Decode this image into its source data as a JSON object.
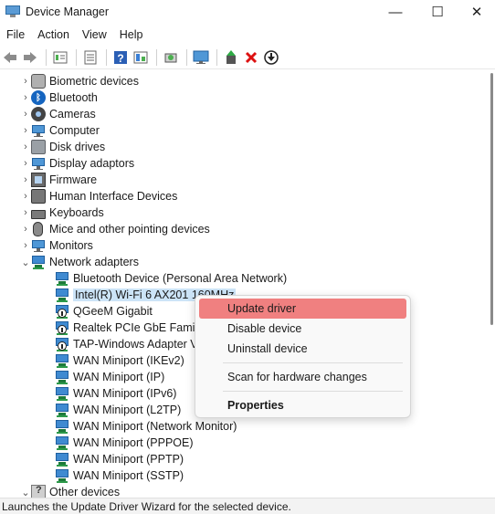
{
  "window": {
    "title": "Device Manager",
    "minimize_glyph": "—",
    "maximize_glyph": "☐",
    "close_glyph": "✕"
  },
  "menu": [
    "File",
    "Action",
    "View",
    "Help"
  ],
  "toolbar": [
    "back-arrow-icon",
    "forward-arrow-icon",
    "properties-view-icon",
    "list-view-icon",
    "help-icon",
    "resources-view-icon",
    "scan-hardware-icon",
    "monitor-icon",
    "update-driver-icon",
    "uninstall-x-icon",
    "disable-device-icon"
  ],
  "tree": {
    "categories": [
      {
        "label": "Biometric devices",
        "icon": "fingerprint-icon",
        "expanded": false
      },
      {
        "label": "Bluetooth",
        "icon": "bluetooth-icon",
        "expanded": false
      },
      {
        "label": "Cameras",
        "icon": "camera-icon",
        "expanded": false
      },
      {
        "label": "Computer",
        "icon": "computer-icon",
        "expanded": false
      },
      {
        "label": "Disk drives",
        "icon": "disk-drive-icon",
        "expanded": false
      },
      {
        "label": "Display adaptors",
        "icon": "display-adapter-icon",
        "expanded": false
      },
      {
        "label": "Firmware",
        "icon": "firmware-icon",
        "expanded": false
      },
      {
        "label": "Human Interface Devices",
        "icon": "hid-icon",
        "expanded": false
      },
      {
        "label": "Keyboards",
        "icon": "keyboard-icon",
        "expanded": false
      },
      {
        "label": "Mice and other pointing devices",
        "icon": "mouse-icon",
        "expanded": false
      },
      {
        "label": "Monitors",
        "icon": "monitor-icon",
        "expanded": false
      },
      {
        "label": "Network adapters",
        "icon": "network-adapter-icon",
        "expanded": true
      }
    ],
    "network_children": [
      {
        "label": "Bluetooth Device (Personal Area Network)",
        "warn": false
      },
      {
        "label": "Intel(R) Wi-Fi 6 AX201 160MHz",
        "warn": false,
        "selected": true
      },
      {
        "label": "QGeeM Gigabit",
        "warn": true
      },
      {
        "label": "Realtek PCIe GbE Family",
        "warn": true
      },
      {
        "label": "TAP-Windows Adapter V9",
        "warn": true
      },
      {
        "label": "WAN Miniport (IKEv2)",
        "warn": false
      },
      {
        "label": "WAN Miniport (IP)",
        "warn": false
      },
      {
        "label": "WAN Miniport (IPv6)",
        "warn": false
      },
      {
        "label": "WAN Miniport (L2TP)",
        "warn": false
      },
      {
        "label": "WAN Miniport (Network Monitor)",
        "warn": false
      },
      {
        "label": "WAN Miniport (PPPOE)",
        "warn": false
      },
      {
        "label": "WAN Miniport (PPTP)",
        "warn": false
      },
      {
        "label": "WAN Miniport (SSTP)",
        "warn": false
      }
    ],
    "trailing": [
      {
        "label": "Other devices",
        "icon": "other-devices-icon",
        "expanded": true
      }
    ]
  },
  "context_menu": {
    "update": "Update driver",
    "disable": "Disable device",
    "uninstall": "Uninstall device",
    "scan": "Scan for hardware changes",
    "properties": "Properties"
  },
  "status": "Launches the Update Driver Wizard for the selected device.",
  "colors": {
    "menu_hover": "#f08080",
    "selection": "#cce4f7"
  }
}
